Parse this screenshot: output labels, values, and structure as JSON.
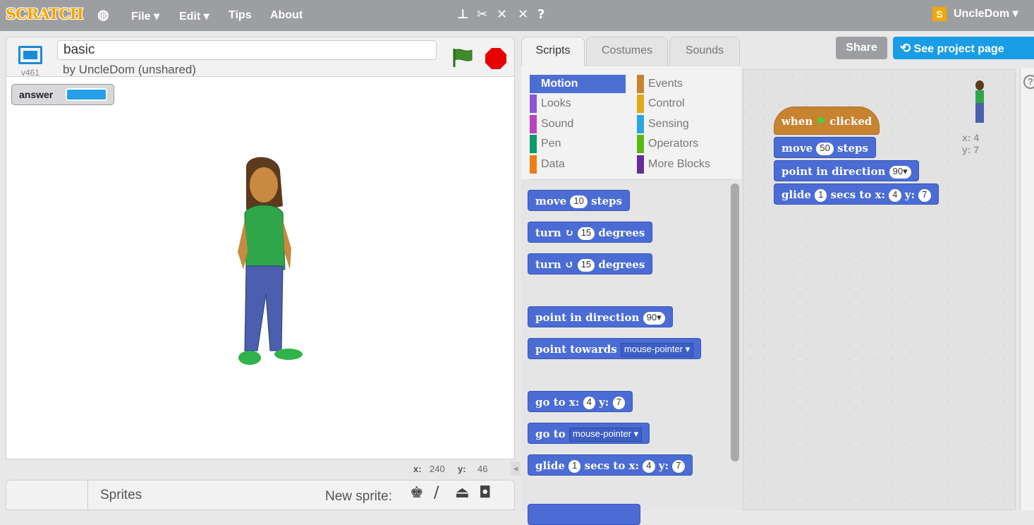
{
  "topbar": {
    "logo": "SCRATCH",
    "menus": [
      "File ▾",
      "Edit ▾",
      "Tips",
      "About"
    ],
    "user": "UncleDom ▾",
    "user_icon": "S"
  },
  "project": {
    "title": "basic",
    "author": "by UncleDom (unshared)",
    "version": "v461"
  },
  "monitor": {
    "label": "answer"
  },
  "coords": {
    "x_label": "x:",
    "x": "240",
    "y_label": "y:",
    "y": "46"
  },
  "sprites": {
    "label": "Sprites",
    "new_sprite": "New sprite:"
  },
  "tabs": [
    "Scripts",
    "Costumes",
    "Sounds"
  ],
  "buttons": {
    "share": "Share",
    "see_project": "See project page"
  },
  "categories": [
    {
      "name": "Motion",
      "color": "#4a6cd4"
    },
    {
      "name": "Events",
      "color": "#c88330"
    },
    {
      "name": "Looks",
      "color": "#8a55d7"
    },
    {
      "name": "Control",
      "color": "#e1a91a"
    },
    {
      "name": "Sound",
      "color": "#bb42c3"
    },
    {
      "name": "Sensing",
      "color": "#2ca5e2"
    },
    {
      "name": "Pen",
      "color": "#0e9a6c"
    },
    {
      "name": "Operators",
      "color": "#5cb712"
    },
    {
      "name": "Data",
      "color": "#ee7d16"
    },
    {
      "name": "More Blocks",
      "color": "#632d99"
    }
  ],
  "palette": {
    "move": "move",
    "move_n": "10",
    "steps": "steps",
    "turn": "turn",
    "turn_n1": "15",
    "turn_n2": "15",
    "degrees": "degrees",
    "point_dir": "point in direction",
    "point_dir_n": "90▾",
    "point_towards": "point towards",
    "mouse_pointer": "mouse-pointer ▾",
    "goto_xy": "go to x:",
    "x_val": "4",
    "y_lbl": "y:",
    "y_val": "7",
    "goto": "go to",
    "glide": "glide",
    "glide_n": "1",
    "secs_to_x": "secs to x:"
  },
  "script": {
    "when": "when",
    "clicked": "clicked",
    "move_n": "50",
    "dir_n": "90▾",
    "glide_n": "1",
    "x_val": "4",
    "y_val": "7"
  },
  "sprite_info": {
    "x": "x: 4",
    "y": "y: 7"
  }
}
